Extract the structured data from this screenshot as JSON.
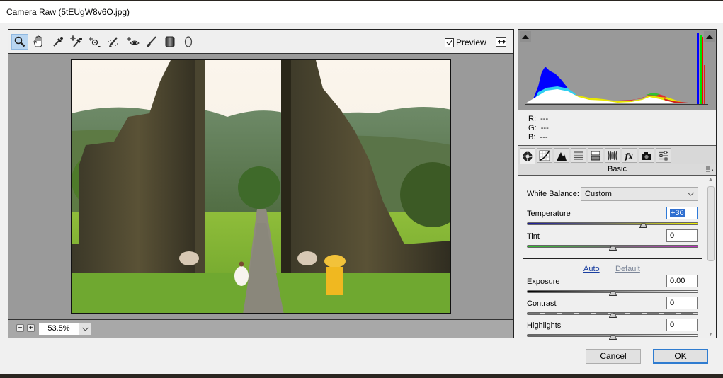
{
  "window": {
    "title": "Camera Raw (5tEUgW8v6O.jpg)"
  },
  "toolbar": {
    "tools": [
      {
        "name": "zoom-tool",
        "icon": "magnifier-icon",
        "active": true
      },
      {
        "name": "hand-tool",
        "icon": "hand-icon",
        "active": false
      },
      {
        "name": "white-balance-tool",
        "icon": "eyedropper-icon",
        "active": false
      },
      {
        "name": "color-sampler-tool",
        "icon": "color-sampler-icon",
        "active": false
      },
      {
        "name": "targeted-adjustment-tool",
        "icon": "target-adjust-icon",
        "active": false
      },
      {
        "name": "spot-removal-tool",
        "icon": "spot-removal-icon",
        "active": false
      },
      {
        "name": "red-eye-tool",
        "icon": "red-eye-icon",
        "active": false
      },
      {
        "name": "adjustment-brush-tool",
        "icon": "brush-icon",
        "active": false
      },
      {
        "name": "graduated-filter-tool",
        "icon": "graduated-filter-icon",
        "active": false
      },
      {
        "name": "radial-filter-tool",
        "icon": "radial-filter-icon",
        "active": false
      }
    ],
    "preview_label": "Preview",
    "preview_checked": true
  },
  "zoom": {
    "minus": "−",
    "plus": "+",
    "value": "53.5%"
  },
  "histogram": {
    "r_label": "R:",
    "g_label": "G:",
    "b_label": "B:",
    "r_value": "---",
    "g_value": "---",
    "b_value": "---"
  },
  "panel_tabs": [
    {
      "name": "basic",
      "icon": "aperture-icon",
      "active": true
    },
    {
      "name": "tone-curve",
      "icon": "tone-curve-icon",
      "active": false
    },
    {
      "name": "detail",
      "icon": "detail-icon",
      "active": false
    },
    {
      "name": "hsl",
      "icon": "hsl-icon",
      "active": false
    },
    {
      "name": "split-toning",
      "icon": "split-toning-icon",
      "active": false
    },
    {
      "name": "lens-corrections",
      "icon": "lens-icon",
      "active": false
    },
    {
      "name": "effects",
      "icon": "fx-icon",
      "active": false
    },
    {
      "name": "camera-calibration",
      "icon": "camera-icon",
      "active": false
    },
    {
      "name": "presets",
      "icon": "sliders-icon",
      "active": false
    }
  ],
  "basic": {
    "section_title": "Basic",
    "white_balance_label": "White Balance:",
    "white_balance_value": "Custom",
    "auto_label": "Auto",
    "default_label": "Default",
    "sliders": [
      {
        "label": "Temperature",
        "value": "+36",
        "position": 0.68,
        "focused": true
      },
      {
        "label": "Tint",
        "value": "0",
        "position": 0.5,
        "focused": false
      },
      {
        "label": "Exposure",
        "value": "0.00",
        "position": 0.5,
        "focused": false
      },
      {
        "label": "Contrast",
        "value": "0",
        "position": 0.5,
        "focused": false
      },
      {
        "label": "Highlights",
        "value": "0",
        "position": 0.5,
        "focused": false
      }
    ]
  },
  "buttons": {
    "cancel": "Cancel",
    "ok": "OK"
  }
}
